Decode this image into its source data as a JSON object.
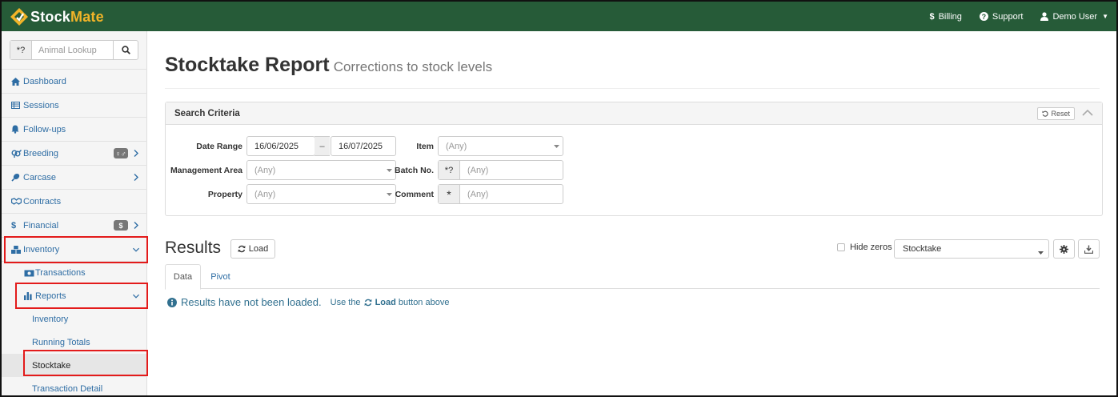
{
  "brand": {
    "name_part1": "Stock",
    "name_part2": "Mate",
    "colors": {
      "topbar": "#265b38",
      "accent": "#f2b428",
      "link": "#2e6da4",
      "highlight": "#e31b1b"
    }
  },
  "topnav": {
    "billing": "Billing",
    "support": "Support",
    "user": "Demo User"
  },
  "sidebar": {
    "lookup": {
      "addon": "*?",
      "placeholder": "Animal Lookup"
    },
    "items": [
      {
        "label": "Dashboard",
        "icon": "home-icon"
      },
      {
        "label": "Sessions",
        "icon": "table-icon"
      },
      {
        "label": "Follow-ups",
        "icon": "bell-icon"
      },
      {
        "label": "Breeding",
        "icon": "venus-mars-icon",
        "badge": "♀♂"
      },
      {
        "label": "Carcase",
        "icon": "drumstick-icon"
      },
      {
        "label": "Contracts",
        "icon": "handshake-icon"
      },
      {
        "label": "Financial",
        "icon": "dollar-icon",
        "badge": "$"
      },
      {
        "label": "Inventory",
        "icon": "boxes-icon"
      }
    ],
    "inventory_children": {
      "transactions": "Transactions",
      "reports": "Reports",
      "report_items": [
        "Inventory",
        "Running Totals",
        "Stocktake",
        "Transaction Detail"
      ]
    }
  },
  "page": {
    "title": "Stocktake Report",
    "subtitle": "Corrections to stock levels"
  },
  "search": {
    "heading": "Search Criteria",
    "reset": "Reset",
    "date_range_label": "Date Range",
    "date_from": "16/06/2025",
    "date_sep": "–",
    "date_to": "16/07/2025",
    "management_area_label": "Management Area",
    "management_area_placeholder": "(Any)",
    "property_label": "Property",
    "property_placeholder": "(Any)",
    "item_label": "Item",
    "item_placeholder": "(Any)",
    "batch_label": "Batch No.",
    "batch_addon": "*?",
    "batch_placeholder": "(Any)",
    "comment_label": "Comment",
    "comment_addon": "*",
    "comment_placeholder": "(Any)"
  },
  "results": {
    "title": "Results",
    "load_label": "Load",
    "hide_zeros_label": "Hide zeros",
    "report_select": "Stocktake",
    "tabs": [
      "Data",
      "Pivot"
    ],
    "notice": "Results have not been loaded.",
    "hint_prefix": "Use the",
    "hint_bold": "Load",
    "hint_suffix": "button above"
  }
}
